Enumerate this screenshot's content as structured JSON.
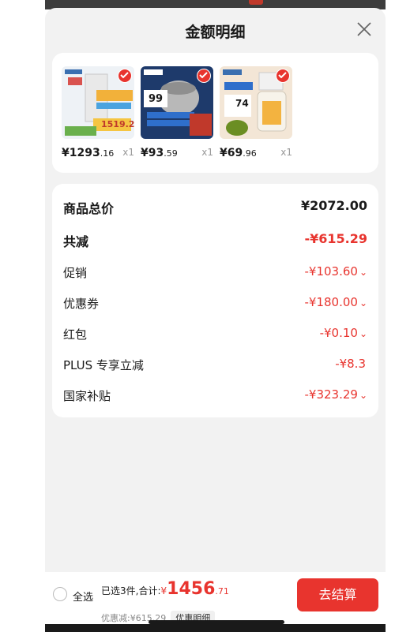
{
  "sheet": {
    "title": "金额明细"
  },
  "products": [
    {
      "price_int": "¥1293",
      "price_dec": ".16",
      "qty": "x1",
      "thumb_text": "1519.2",
      "checked": true
    },
    {
      "price_int": "¥93",
      "price_dec": ".59",
      "qty": "x1",
      "thumb_text": "99",
      "checked": true
    },
    {
      "price_int": "¥69",
      "price_dec": ".96",
      "qty": "x1",
      "thumb_text": "74",
      "checked": true
    }
  ],
  "summary": {
    "total": {
      "label": "商品总价",
      "value": "¥2072.00"
    },
    "reduced": {
      "label": "共减",
      "value": "-¥615.29"
    },
    "items": [
      {
        "label": "促销",
        "value": "-¥103.60",
        "chevron": "⌄"
      },
      {
        "label": "优惠券",
        "value": "-¥180.00",
        "chevron": "⌄"
      },
      {
        "label": "红包",
        "value": "-¥0.10",
        "chevron": "⌄"
      },
      {
        "label": "PLUS 专享立减",
        "value": "-¥8.3",
        "chevron": ""
      },
      {
        "label": "国家补贴",
        "value": "-¥323.29",
        "chevron": "⌄"
      }
    ]
  },
  "bottom": {
    "select_all": "全选",
    "selected_text": "已选3件,合计:",
    "currency": "¥",
    "amount_int": "1456",
    "amount_dec": ".71",
    "discount_text": "优惠减:¥615.29",
    "detail_label": "优惠明细",
    "checkout_label": "去结算"
  },
  "colors": {
    "accent": "#e8342e",
    "sheet_bg": "#f2f2f2"
  }
}
